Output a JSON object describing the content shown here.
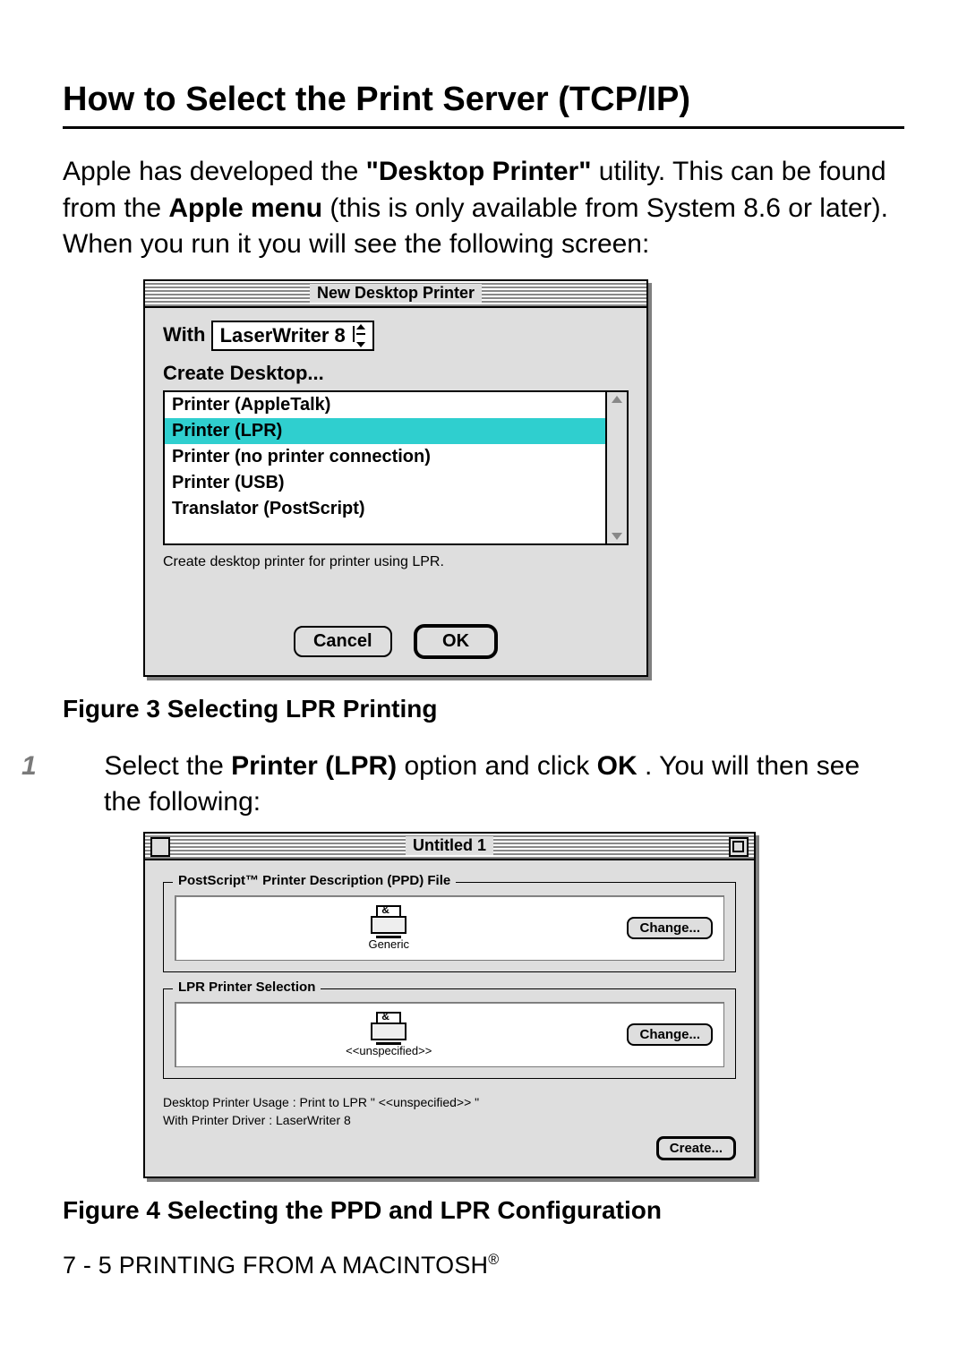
{
  "heading": "How to Select the Print Server (TCP/IP)",
  "intro_parts": {
    "p1": "Apple has developed the ",
    "b1": "\"Desktop Printer\"",
    "p2": " utility. This can be found from the ",
    "b2": "Apple menu",
    "p3": " (this is only available from System 8.6 or later). When you run it you will see the following screen:"
  },
  "dialog1": {
    "title": "New Desktop Printer",
    "with_label": "With",
    "popup_value": "LaserWriter 8",
    "create_label": "Create Desktop...",
    "list": [
      "Printer (AppleTalk)",
      "Printer (LPR)",
      "Printer (no printer connection)",
      "Printer (USB)",
      "Translator (PostScript)"
    ],
    "selected_index": 1,
    "hint": "Create desktop printer for printer using LPR.",
    "cancel": "Cancel",
    "ok": "OK"
  },
  "fig3": "Figure 3 Selecting LPR Printing",
  "step1": {
    "num": "1",
    "p1": "Select the ",
    "b1": "Printer (LPR)",
    "p2": " option and click ",
    "b2": "OK",
    "p3": ". You will then see the following:"
  },
  "dialog2": {
    "title": "Untitled 1",
    "group_ppd": "PostScript™ Printer Description (PPD) File",
    "ppd_value": "Generic",
    "change": "Change...",
    "group_lpr": "LPR Printer Selection",
    "lpr_value": "<<unspecified>>",
    "usage": "Desktop Printer Usage : Print to LPR \" <<unspecified>> \"",
    "driver": "With Printer Driver : LaserWriter 8",
    "create": "Create..."
  },
  "fig4": "Figure 4 Selecting the PPD and LPR Configuration",
  "footer": "7 - 5 PRINTING FROM A MACINTOSH"
}
